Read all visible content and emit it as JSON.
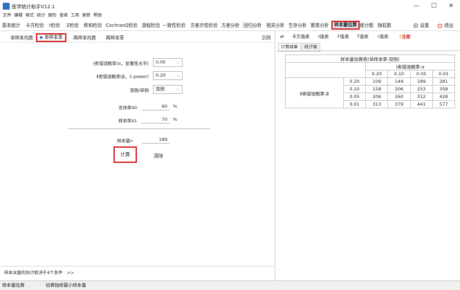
{
  "window": {
    "title": "医学统计助手V12.1",
    "min": "—",
    "max": "☐",
    "close": "✕"
  },
  "menu": [
    "文件",
    "编辑",
    "格式",
    "统计",
    "图形",
    "查表",
    "工具",
    "更新",
    "帮助"
  ],
  "toolbar": {
    "tabs": [
      "基本统计",
      "卡方检验",
      "t检验",
      "Z检验",
      "秩和检验",
      "CochranQ检验",
      "游程检验",
      "一致性检验",
      "方差齐性检验",
      "方差分析",
      "回归分析",
      "相关分析",
      "生存分析",
      "聚类分析",
      "样本量估算",
      "统计图",
      "随机数"
    ],
    "settings": "设置",
    "exit": "退出"
  },
  "subtabs": {
    "items": [
      "单样本均数",
      "单样本率",
      "两样本均数",
      "两样本率"
    ],
    "example": "示例"
  },
  "form": {
    "alpha_label": "Ⅰ类错误概率(α，显著性水平)",
    "alpha_value": "0.05",
    "beta_label": "Ⅱ类错误概率(β，1-power)",
    "beta_value": "0.20",
    "sides_label": "双侧/单侧",
    "sides_value": "双侧",
    "pi0_label": "总体率π0",
    "pi0_value": "60",
    "pi1_label": "样本率π1",
    "pi1_value": "70",
    "pct": "%",
    "n_label": "样本量n",
    "n_value": "189",
    "calc_label": "计算",
    "clear_label": "清除"
  },
  "footnote": "样本含量的估计取决于4个条件　>>",
  "right_tabs": [
    "卡方值表",
    "t值表",
    "F值表",
    "T值表",
    "r值表",
    "注册"
  ],
  "result_tabs": [
    "计算结果",
    "统计图"
  ],
  "table": {
    "title": "样本量估算表(单样本率-双侧)",
    "alpha_header": "Ⅰ类错误概率-α",
    "beta_header": "Ⅱ类错误概率-β",
    "alphas": [
      "0.20",
      "0.10",
      "0.05",
      "0.01"
    ],
    "rows": [
      {
        "beta": "0.20",
        "values": [
          "109",
          "149",
          "189",
          "281"
        ]
      },
      {
        "beta": "0.10",
        "values": [
          "158",
          "206",
          "253",
          "358"
        ]
      },
      {
        "beta": "0.05",
        "values": [
          "206",
          "260",
          "312",
          "428"
        ]
      },
      {
        "beta": "0.01",
        "values": [
          "313",
          "379",
          "441",
          "577"
        ]
      }
    ]
  },
  "status": {
    "left": "样本量估算",
    "right": "估算独样最小样本量"
  },
  "colors": {
    "accent_red": "#d42a2a",
    "selected_bg": "#dfe7f3",
    "register_red": "#d42a2a"
  }
}
